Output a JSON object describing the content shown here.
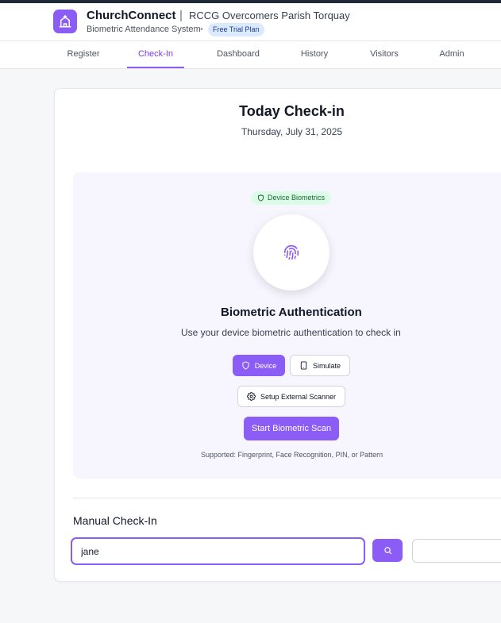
{
  "header": {
    "app_name": "ChurchConnect",
    "separator": "|",
    "parish": "RCCG Overcomers Parish Torquay",
    "subtitle": "Biometric Attendance System",
    "dot": "•",
    "plan_badge": "Free Trial Plan",
    "logo_icon": "church-icon"
  },
  "nav": {
    "tabs": [
      {
        "label": "Register"
      },
      {
        "label": "Check-In",
        "active": true
      },
      {
        "label": "Dashboard"
      },
      {
        "label": "History"
      },
      {
        "label": "Visitors"
      },
      {
        "label": "Admin"
      }
    ]
  },
  "checkin": {
    "title": "Today Check-in",
    "date": "Thursday, July 31, 2025"
  },
  "biometric": {
    "badge": "Device Biometrics",
    "badge_icon": "shield-icon",
    "center_icon": "fingerprint-icon",
    "title": "Biometric Authentication",
    "description": "Use your device biometric authentication to check in",
    "device_button": "Device",
    "simulate_button": "Simulate",
    "setup_button": "Setup External Scanner",
    "start_button": "Start Biometric Scan",
    "supported": "Supported: Fingerprint, Face Recognition, PIN, or Pattern"
  },
  "manual": {
    "title": "Manual Check-In",
    "search_value": "jane",
    "search_icon": "search-icon"
  },
  "colors": {
    "accent": "#8b5cf6",
    "badge_green_bg": "#dcfce7",
    "badge_blue_bg": "#dbeafe"
  }
}
